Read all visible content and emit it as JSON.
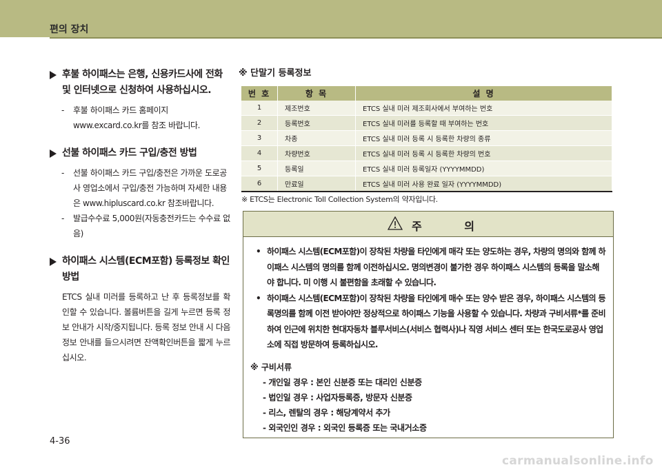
{
  "header": {
    "title": "편의 장치"
  },
  "left": {
    "sections": [
      {
        "heading": "후불 하이패스는 은행, 신용카드사에 전화 및 인터넷으로 신청하여 사용하십시오.",
        "items": [
          "후불 하이패스 카드 홈페이지 www.excard.co.kr를 참조 바랍니다."
        ]
      },
      {
        "heading": "선불 하이패스 카드 구입/충전 방법",
        "items": [
          "선불 하이패스 카드 구입/충전은 가까운 도로공사 영업소에서 구입/충전 가능하며 자세한 내용은 www.hipluscard.co.kr 참조바랍니다.",
          "발급수수료 5,000원(자동충전카드는 수수료 없음)"
        ]
      },
      {
        "heading": "하이패스 시스템(ECM포함) 등록정보 확인방법",
        "paragraph": "ETCS 실내 미러를 등록하고 난 후 등록정보를 확인할 수 있습니다. 볼륨버튼을 길게 누르면 등록 정보 안내가 시작/중지됩니다. 등록 정보 안내 시 다음 정보 안내를 들으시려면 잔액확인버튼을 짧게 누르십시오."
      }
    ]
  },
  "right": {
    "note_title": "※ 단말기 등록정보",
    "table": {
      "headers": [
        "번 호",
        "항 목",
        "설 명"
      ],
      "rows": [
        [
          "1",
          "제조번호",
          "ETCS 실내 미러 제조회사에서 부여하는 번호"
        ],
        [
          "2",
          "등록번호",
          "ETCS 실내 미러를 등록할 때 부여하는 번호"
        ],
        [
          "3",
          "차종",
          "ETCS 실내 미러 등록 시 등록한 차량의 종류"
        ],
        [
          "4",
          "차량번호",
          "ETCS 실내 미러 등록 시 등록한 차량의 번호"
        ],
        [
          "5",
          "등록일",
          "ETCS 실내 미러 등록일자 (YYYYMMDD)"
        ],
        [
          "6",
          "만료일",
          "ETCS 실내 미러 사용 완료 일자 (YYYYMMDD)"
        ]
      ]
    },
    "footnote": "※ ETCS는 Electronic Toll Collection System의 약자입니다."
  },
  "caution": {
    "title": "주 의",
    "bullets": [
      "하이패스 시스템(ECM포함)이 장착된 차량을 타인에게 매각 또는 양도하는 경우, 차량의 명의와 함께 하이패스 시스템의 명의를 함께 이전하십시오. 명의변경이 불가한 경우 하이패스 시스템의 등록을 말소해야 합니다. 미 이행 시 불편함을 초래할 수 있습니다.",
      "하이패스 시스템(ECM포함)이 장착된 차량을 타인에게 매수 또는 양수 받은 경우, 하이패스 시스템의 등록명의를 함께 이전 받아야만 정상적으로 하이패스 기능을 사용할 수 있습니다. 차량과 구비서류*를 준비하여 인근에 위치한 현대자동차 블루서비스(서비스 협력사)나 직영 서비스 센터 또는 한국도로공사 영업소에 직접 방문하여 등록하십시오."
    ],
    "docs_title": "※ 구비서류",
    "docs": [
      "- 개인일 경우 : 본인 신분증 또는 대리인 신분증",
      "- 법인일 경우 : 사업자등록증, 방문자 신분증",
      "- 리스, 렌탈의 경우 : 해당계약서 추가",
      "- 외국인인 경우 : 외국인 등록증 또는 국내거소증"
    ]
  },
  "footer": {
    "page": "4-36",
    "watermark": "carmanualsonline.info"
  }
}
